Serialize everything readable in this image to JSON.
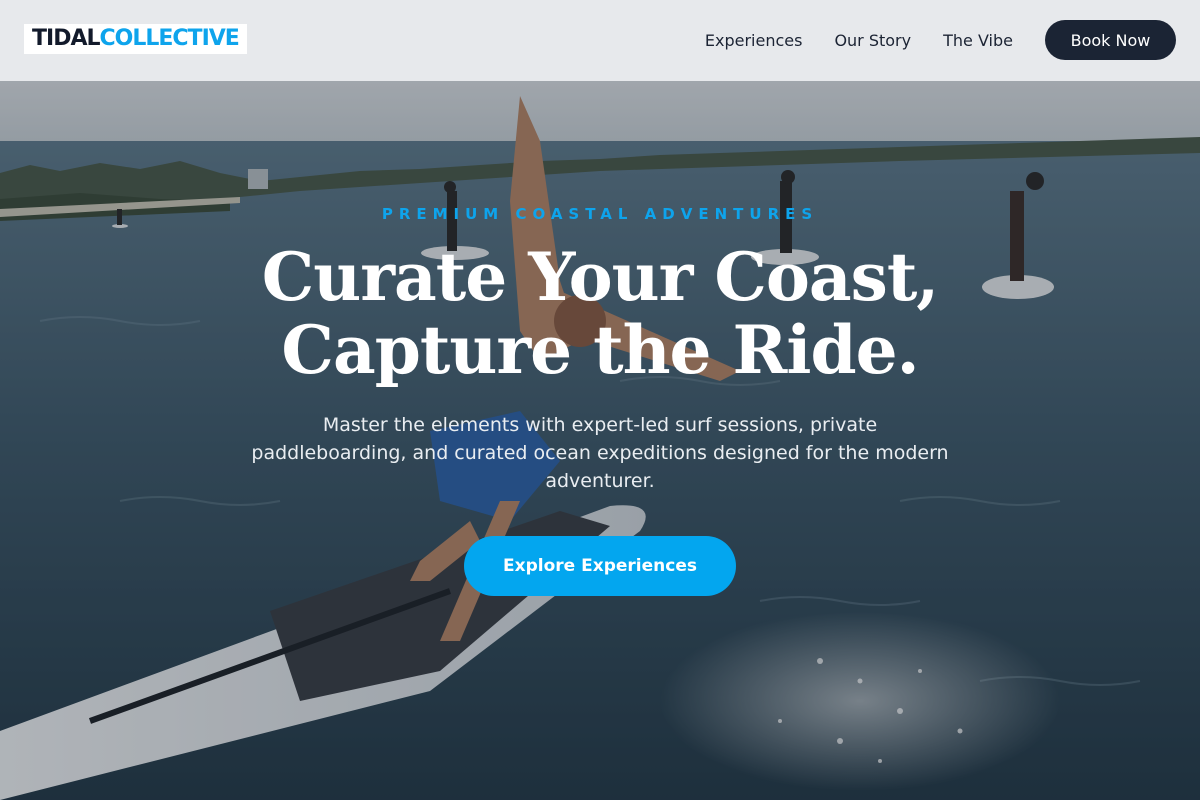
{
  "brand": {
    "word1": "TIDAL",
    "word2": "COLLECTIVE",
    "colors": {
      "dark": "#121a2b",
      "accent": "#0ea4ec"
    }
  },
  "nav": {
    "links": [
      "Experiences",
      "Our Story",
      "The Vibe"
    ],
    "cta_label": "Book Now"
  },
  "hero": {
    "eyebrow": "PREMIUM COASTAL ADVENTURES",
    "headline_line1": "Curate Your Coast,",
    "headline_line2": "Capture the Ride.",
    "subtext": "Master the elements with expert-led surf sessions, private paddleboarding, and curated ocean expeditions designed for the modern adventurer.",
    "cta_label": "Explore Experiences",
    "background_image": "paddleboarders-on-bay-photo"
  }
}
